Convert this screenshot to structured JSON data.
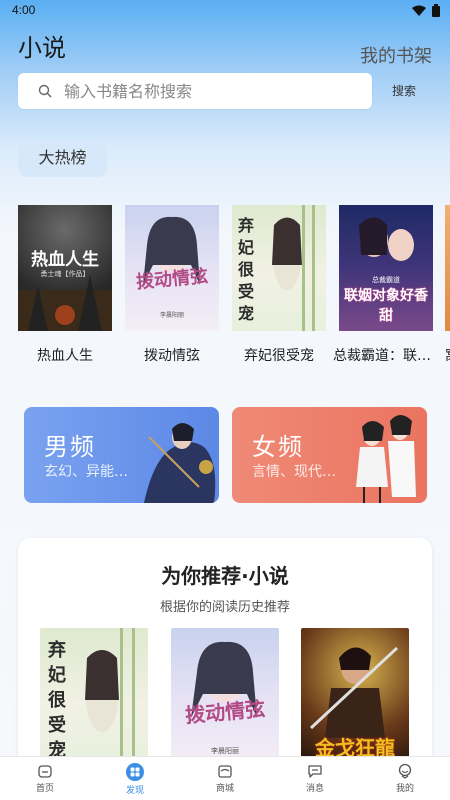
{
  "status": {
    "time": "4:00"
  },
  "header": {
    "title": "小说",
    "shelf_label": "我的书架"
  },
  "search": {
    "placeholder": "输入书籍名称搜索",
    "button_label": "搜索"
  },
  "hot": {
    "chip_label": "大热榜",
    "books": [
      {
        "title": "热血人生",
        "cover_text": "热血人生",
        "cover_subtext": "勇士魂【作品】"
      },
      {
        "title": "拨动情弦",
        "cover_text": "拨动情弦",
        "cover_subtext": "李晨阳丽"
      },
      {
        "title": "弃妃很受宠",
        "cover_text": "弃妃很受宠",
        "cover_subtext": ""
      },
      {
        "title": "总裁霸道：联姻对象好香甜",
        "cover_text": "联姻对象好香甜",
        "cover_subtext": "总裁霸道"
      },
      {
        "title": "窝",
        "cover_text": "",
        "cover_subtext": ""
      }
    ]
  },
  "categories": [
    {
      "title": "男频",
      "subtitle": "玄幻、异能…"
    },
    {
      "title": "女频",
      "subtitle": "言情、现代…"
    }
  ],
  "recommend": {
    "title": "为你推荐·小说",
    "subtitle": "根据你的阅读历史推荐",
    "books": [
      {
        "cover_text": "弃妃很受宠"
      },
      {
        "cover_text": "拨动情弦",
        "cover_subtext": "李晨阳丽"
      },
      {
        "cover_text": "金戈狂龍"
      }
    ]
  },
  "nav": {
    "items": [
      {
        "label": "首页",
        "icon": "home-icon"
      },
      {
        "label": "发现",
        "icon": "discover-icon"
      },
      {
        "label": "商城",
        "icon": "store-icon"
      },
      {
        "label": "消息",
        "icon": "message-icon"
      },
      {
        "label": "我的",
        "icon": "profile-icon"
      }
    ],
    "active_index": 1
  },
  "colors": {
    "accent": "#3a8ee6",
    "male_card": "#6f9ef0",
    "female_card": "#ee7f6c"
  }
}
